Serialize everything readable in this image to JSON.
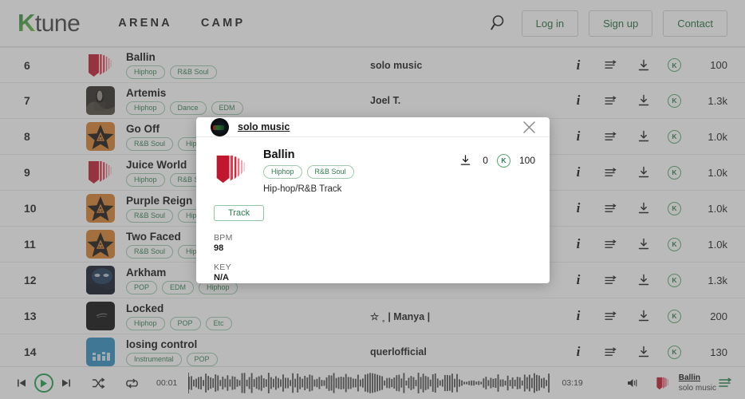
{
  "header": {
    "logo_k": "K",
    "logo_rest": "tune",
    "nav": [
      {
        "label": "ARENA"
      },
      {
        "label": "CAMP"
      }
    ],
    "search_icon": "search-icon",
    "buttons": [
      {
        "label": "Log in",
        "name": "login-button"
      },
      {
        "label": "Sign up",
        "name": "signup-button"
      },
      {
        "label": "Contact",
        "name": "contact-button"
      }
    ],
    "accent_green": "#1f6b3a"
  },
  "table": {
    "rows": [
      {
        "rank": "6",
        "title": "Ballin",
        "tags": [
          "Hiphop",
          "R&B Soul"
        ],
        "artist": "solo music",
        "count": "100",
        "art": "shield-red"
      },
      {
        "rank": "7",
        "title": "Artemis",
        "tags": [
          "Hiphop",
          "Dance",
          "EDM"
        ],
        "artist": "Joel T.",
        "count": "1.3k",
        "art": "photo-dark"
      },
      {
        "rank": "8",
        "title": "Go Off",
        "tags": [
          "R&B Soul",
          "Hiphop"
        ],
        "artist": "",
        "count": "1.0k",
        "art": "star-orange"
      },
      {
        "rank": "9",
        "title": "Juice World",
        "tags": [
          "Hiphop",
          "R&B Soul"
        ],
        "artist": "",
        "count": "1.0k",
        "art": "shield-red"
      },
      {
        "rank": "10",
        "title": "Purple Reign",
        "tags": [
          "R&B Soul",
          "Hiphop"
        ],
        "artist": "",
        "count": "1.0k",
        "art": "star-orange"
      },
      {
        "rank": "11",
        "title": "Two Faced",
        "tags": [
          "R&B Soul",
          "Hiphop"
        ],
        "artist": "",
        "count": "1.0k",
        "art": "star-orange"
      },
      {
        "rank": "12",
        "title": "Arkham",
        "tags": [
          "POP",
          "EDM",
          "Hiphop"
        ],
        "artist": "Joel T.",
        "count": "1.3k",
        "art": "photo-blue"
      },
      {
        "rank": "13",
        "title": "Locked",
        "tags": [
          "Hiphop",
          "POP",
          "Etc"
        ],
        "artist": "☆ ˳ | Manya |",
        "count": "200",
        "art": "photo-black"
      },
      {
        "rank": "14",
        "title": "losing control",
        "tags": [
          "Instrumental",
          "POP"
        ],
        "artist": "querlofficial",
        "count": "130",
        "art": "equalizer-blue"
      }
    ],
    "action_icons": {
      "info": "info-icon",
      "queue": "add-to-queue-icon",
      "download": "download-icon",
      "k_badge": "K"
    }
  },
  "modal": {
    "owner": "solo music",
    "avatar_icon": "user-avatar",
    "close_icon": "close-icon",
    "title": "Ballin",
    "tags": [
      "Hiphop",
      "R&B Soul"
    ],
    "subtitle": "Hip-hop/R&B Track",
    "download_icon": "download-icon",
    "download_count": "0",
    "k_badge": "K",
    "k_count": "100",
    "type_pill": "Track",
    "bpm_label": "BPM",
    "bpm_value": "98",
    "key_label": "KEY",
    "key_value": "N/A"
  },
  "player": {
    "prev_icon": "previous-track-icon",
    "play_icon": "play-icon",
    "next_icon": "next-track-icon",
    "shuffle_icon": "shuffle-icon",
    "repeat_icon": "repeat-icon",
    "current_time": "00:01",
    "total_time": "03:19",
    "volume_icon": "volume-icon",
    "track_title": "Ballin",
    "track_artist": "solo music",
    "queue_icon": "queue-list-icon",
    "waveform_color": "#4a4a4a"
  }
}
